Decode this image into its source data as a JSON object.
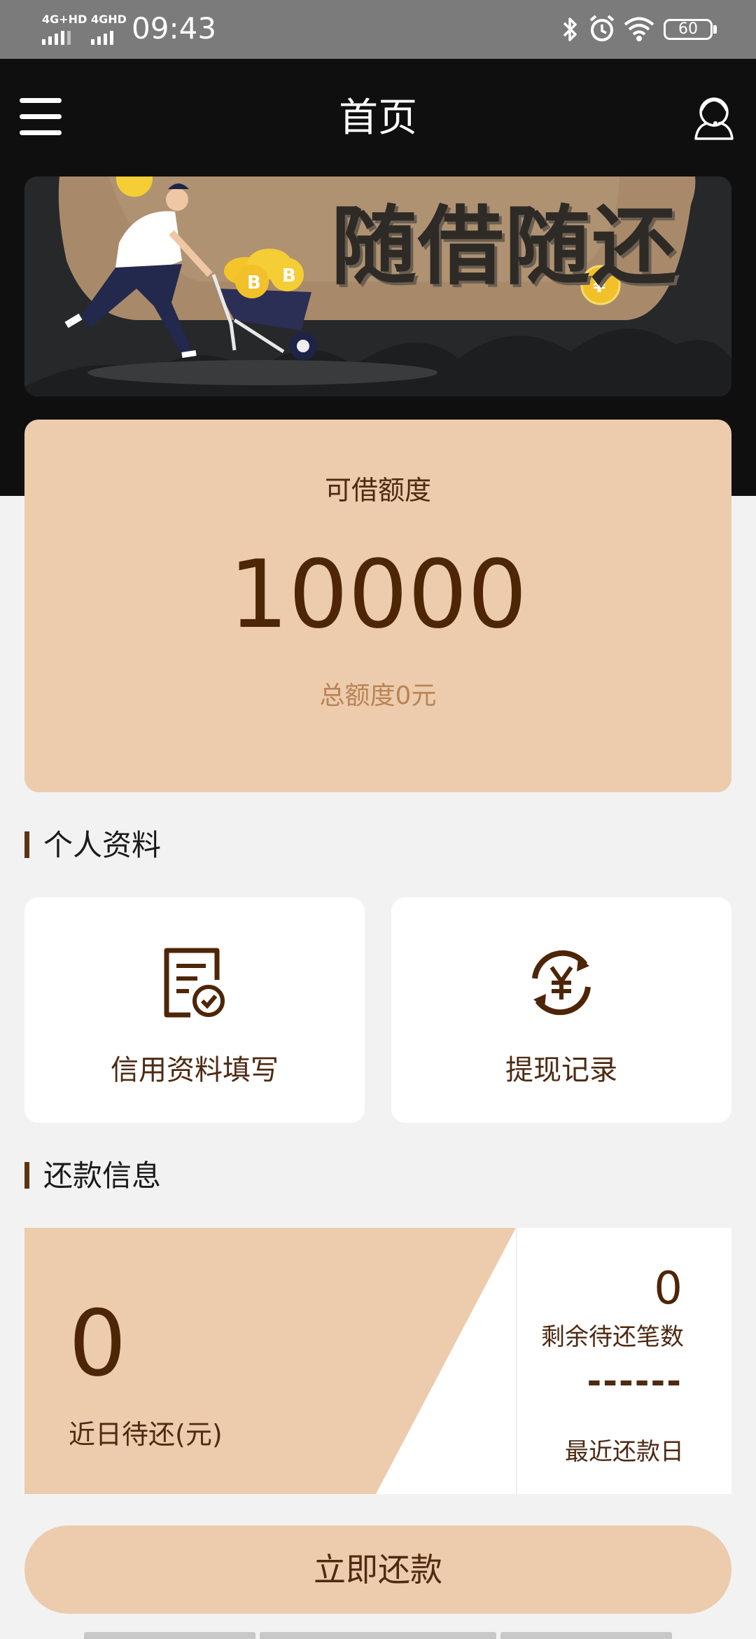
{
  "status_bar": {
    "time": "09:43",
    "network_1": "4G+HD",
    "network_2": "4GHD",
    "battery": "60"
  },
  "header": {
    "title": "首页",
    "menu_icon": "hamburger-menu-icon",
    "support_icon": "customer-service-icon"
  },
  "banner": {
    "headline": "随借随还"
  },
  "quota": {
    "label": "可借额度",
    "amount": "10000",
    "total": "总额度0元"
  },
  "personal_section": {
    "title": "个人资料",
    "tiles": [
      {
        "label": "信用资料填写",
        "icon": "credit-document-check-icon"
      },
      {
        "label": "提现记录",
        "icon": "yuan-refresh-icon"
      }
    ]
  },
  "repayment_section": {
    "title": "还款信息",
    "due_amount": "0",
    "due_label": "近日待还(元)",
    "remaining_count": "0",
    "remaining_label": "剩余待还笔数",
    "recent_date": "------",
    "recent_date_label": "最近还款日"
  },
  "actions": {
    "repay_now": "立即还款"
  },
  "colors": {
    "accent": "#ECCCAC",
    "brown_text": "#4D2A12",
    "header_bg": "#0F0F10",
    "page_bg": "#F2F2F2"
  }
}
